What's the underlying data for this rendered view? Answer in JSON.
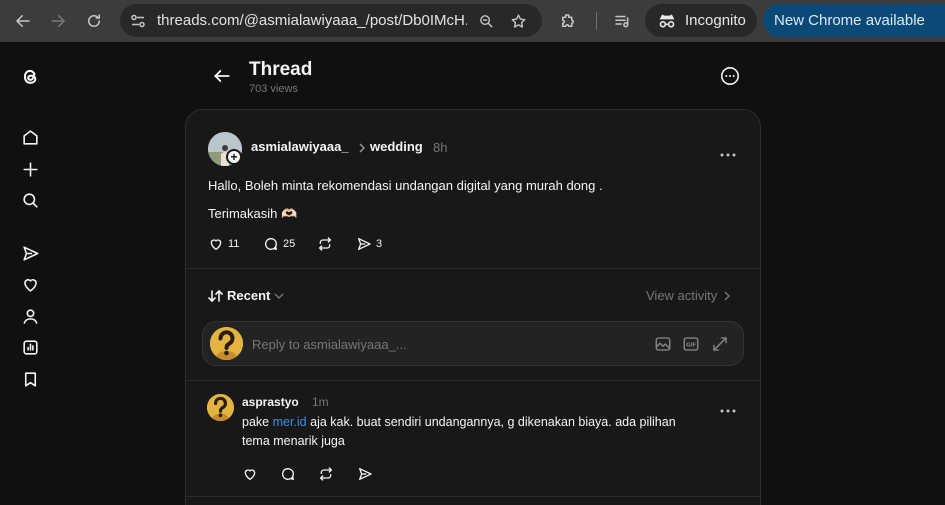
{
  "browser": {
    "url": "threads.com/@asmialawiyaaa_/post/Db0IMcH...",
    "incognito_label": "Incognito",
    "update_label": "New Chrome available"
  },
  "header": {
    "title": "Thread",
    "views": "703 views"
  },
  "post": {
    "username": "asmialawiyaaa_",
    "topic": "wedding",
    "time": "8h",
    "line1": "Hallo, Boleh minta rekomendasi undangan digital yang murah dong .",
    "line2": "Terimakasih 🫶🏻",
    "likes": "11",
    "replies": "25",
    "shares": "3"
  },
  "sort": {
    "label": "Recent",
    "view_activity": "View activity"
  },
  "reply": {
    "placeholder": "Reply to asmialawiyaaa_..."
  },
  "comment": {
    "username": "asprastyo",
    "time": "1m",
    "text_before_link": "pake ",
    "link_text": "mer.id",
    "text_after_link": " aja kak. buat sendiri undangannya, g dikenakan biaya. ada pilihan",
    "line2": "tema menarik juga"
  },
  "colors": {
    "background": "#101010",
    "card": "#181818",
    "text": "#f3f5f7",
    "muted": "#777777",
    "link": "#3b8fe8",
    "update_button": "#0b4a76"
  }
}
